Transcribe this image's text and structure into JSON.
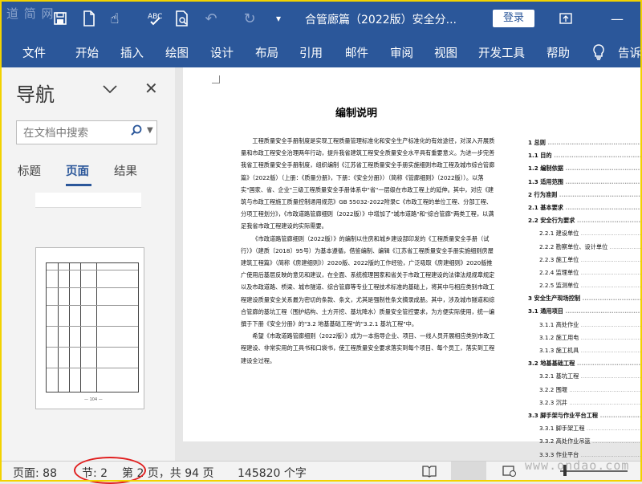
{
  "titlebar": {
    "watermark": "道 简 网",
    "doc_title": "合管廊篇（2022版）安全分...",
    "login": "登录",
    "icons": [
      "save-icon",
      "new-doc-icon",
      "touch-mode-icon",
      "spelling-check-icon",
      "print-preview-icon",
      "undo-icon",
      "redo-icon",
      "customize-quick-access-icon",
      "ribbon-display-icon",
      "minimize-icon"
    ]
  },
  "ribbon": {
    "tabs": [
      "文件",
      "开始",
      "插入",
      "绘图",
      "设计",
      "布局",
      "引用",
      "邮件",
      "审阅",
      "视图",
      "开发工具",
      "帮助"
    ],
    "tell_me": "告诉"
  },
  "nav": {
    "title": "导航",
    "search_placeholder": "在文档中搜索",
    "tabs": [
      "标题",
      "页面",
      "结果"
    ],
    "active_tab": "页面",
    "thumb_page_label": "— 104 —"
  },
  "document": {
    "heading": "编制说明",
    "paragraphs": [
      "工程质量安全手册制度是实现工程质量管理标准化和安全生产标准化的有效途径，对深入开展质量和市政工程安全治理两年行动，提升我省建筑工程安全质量安全水平具有重要意义。为进一步完善我省工程质量安全手册制度，组织编制《江苏省工程质量安全手册实施细则市政工程及城市综合管廊篇》（2022版）（上册：《质量分册》，下册：《安全分册》）（简称《管廊细则》（2022版））。以落实\"国家、省、企业\"三级工程质量安全手册体系中\"省\"一层级在市政工程上的延伸。其中，对应《建筑与市政工程施工质量控制通用规范》GB 55032-2022附录C《市政工程的单位工程、分部工程、分项工程划分》，《市政道路管廊细则（2022版）》中增加了\"城市道路\"和\"综合管廊\"两类工程，以满足我省市政工程建设的实际需要。",
      "《市政道路管廊细则（2022版）》的编制以住房和城乡建设部印发的《工程质量安全手册（试行）》（建质〔2018〕95号）为基本遵循，借鉴编制、编辑《江苏省工程质量安全手册实施细则房屋建筑工程篇》（简称《房建细则》）2020版、2022版的工作经验，广泛吸取《房建细则》2020版推广使用后基层反映的意见和建议，在全面、系统梳理国家和省关于市政工程建设的法律法规规章规定以及市政道路、桥梁、城市隧道、综合管廊等专业工程技术标准的基础上，将其中与相应类别市政工程建设质量安全关系最为密切的条款、条文，尤其是强制性条文摘录成册。其中，涉及城市隧道和综合管廊的基坑工程（围护结构、土方开挖、基坑降水）质量安全管控要求，为方便实际使用，统一编撰于下册《安全分册》的\"3.2 地基基础工程\"的\"3.2.1 基坑工程\"中。",
      "希望《市政道路管廊细则（2022版）》成为一本指导企业、项目、一线人员开展相应类别市政工程建设、非常实用的工具书和口袋书，使工程质量安全要求落实到每个项目、每个员工，落实到工程建设全过程。"
    ],
    "toc": [
      {
        "t": "1 总则",
        "b": true
      },
      {
        "t": "1.1 目的",
        "b": true
      },
      {
        "t": "1.2 编制依据",
        "b": true
      },
      {
        "t": "1.3 适用范围",
        "b": true
      },
      {
        "t": "2 行为准则",
        "b": true
      },
      {
        "t": "2.1 基本要求",
        "b": true
      },
      {
        "t": "2.2 安全行为要求",
        "b": true
      },
      {
        "t": "2.2.1 建设单位",
        "b": false
      },
      {
        "t": "2.2.2 勘察单位、设计单位",
        "b": false
      },
      {
        "t": "2.2.3 施工单位",
        "b": false
      },
      {
        "t": "2.2.4 监理单位",
        "b": false
      },
      {
        "t": "2.2.5 监测单位",
        "b": false
      },
      {
        "t": "3 安全生产现场控制",
        "b": true
      },
      {
        "t": "3.1 通用项目",
        "b": true
      },
      {
        "t": "3.1.1 高处作业",
        "b": false
      },
      {
        "t": "3.1.2 施工用电",
        "b": false
      },
      {
        "t": "3.1.3 施工机具",
        "b": false
      },
      {
        "t": "3.2 地基基础工程",
        "b": true
      },
      {
        "t": "3.2.1 基坑工程",
        "b": false
      },
      {
        "t": "3.2.2 围堰",
        "b": false
      },
      {
        "t": "3.2.3 沉井",
        "b": false
      },
      {
        "t": "3.3 脚手架与作业平台工程",
        "b": true
      },
      {
        "t": "3.3.1 脚手架工程",
        "b": false
      },
      {
        "t": "3.3.2 高处作业吊篮",
        "b": false
      },
      {
        "t": "3.3.3 作业平台",
        "b": false
      }
    ]
  },
  "status": {
    "page": "页面: 88",
    "section": "节: 2",
    "page_of": "第 2 页，共 94 页",
    "words": "145820 个字",
    "watermark": "www.ondao.com"
  }
}
